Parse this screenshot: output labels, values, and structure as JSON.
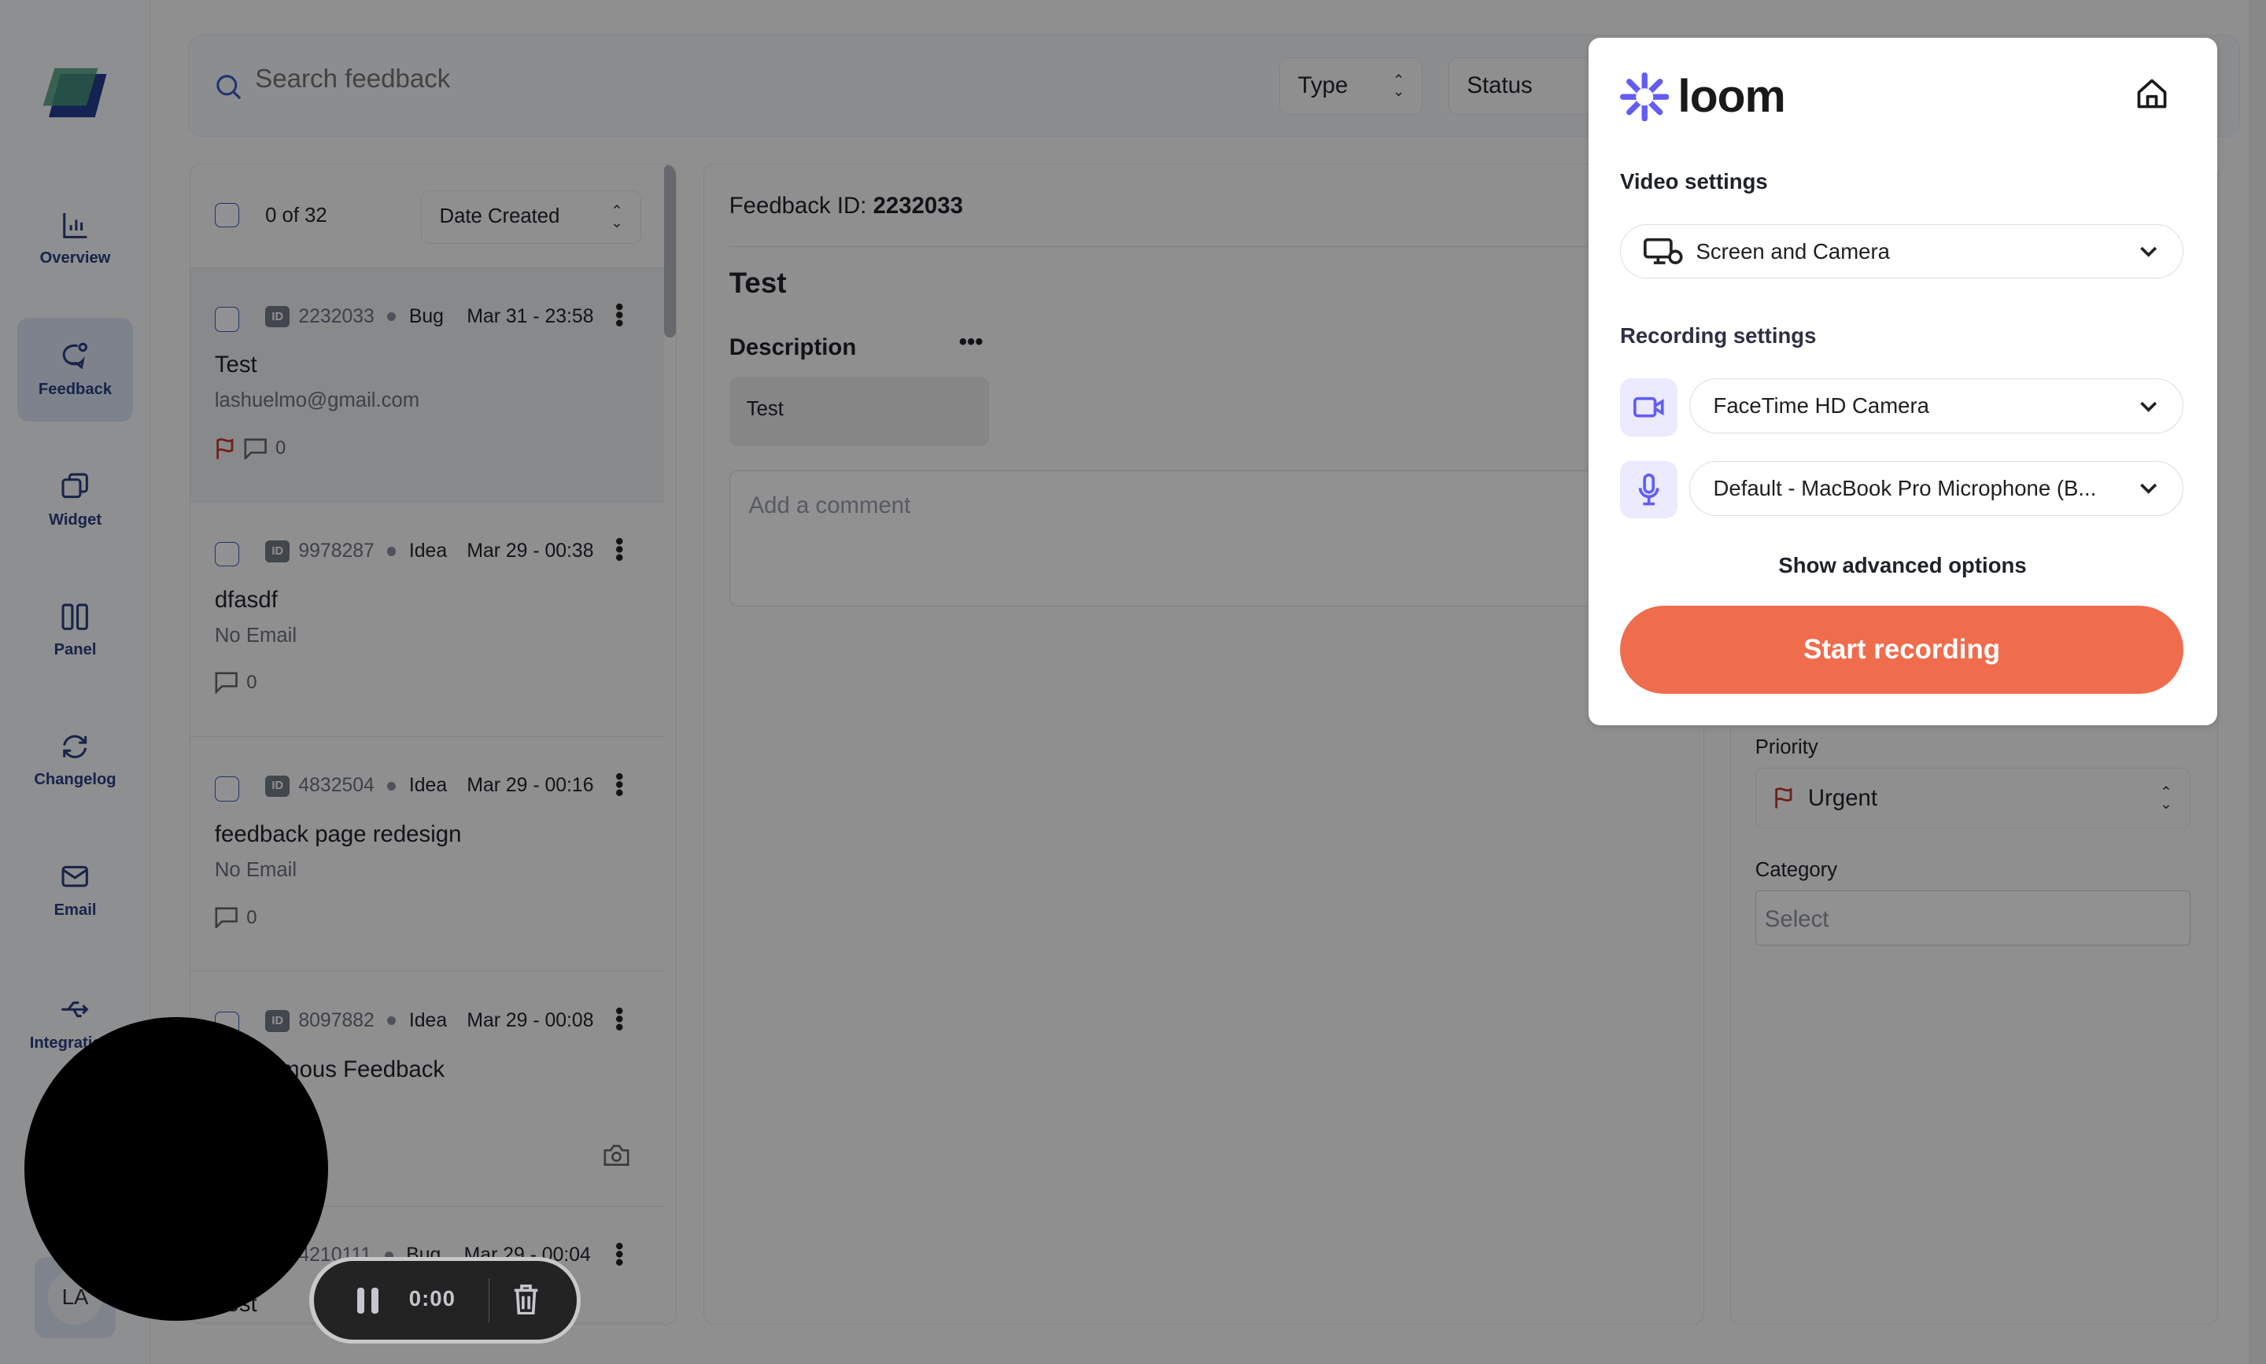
{
  "sidebar": {
    "items": [
      {
        "label": "Overview",
        "icon": "bar-chart-icon"
      },
      {
        "label": "Feedback",
        "icon": "chat-bubble-icon",
        "active": true
      },
      {
        "label": "Widget",
        "icon": "copy-icon"
      },
      {
        "label": "Panel",
        "icon": "columns-icon"
      },
      {
        "label": "Changelog",
        "icon": "refresh-icon"
      },
      {
        "label": "Email",
        "icon": "mail-icon"
      },
      {
        "label": "Integrations",
        "icon": "usb-icon"
      }
    ],
    "avatar": "LA"
  },
  "search": {
    "placeholder": "Search feedback"
  },
  "filters": {
    "type": "Type",
    "status": "Status"
  },
  "list": {
    "count": "0 of 32",
    "sort": "Date Created",
    "items": [
      {
        "id": "2232033",
        "type": "Bug",
        "date": "Mar 31 - 23:58",
        "title": "Test",
        "email": "lashuelmo@gmail.com",
        "comments": "0",
        "flag": true
      },
      {
        "id": "9978287",
        "type": "Idea",
        "date": "Mar 29 - 00:38",
        "title": "dfasdf",
        "email": "No Email",
        "comments": "0"
      },
      {
        "id": "4832504",
        "type": "Idea",
        "date": "Mar 29 - 00:16",
        "title": "feedback page redesign",
        "email": "No Email",
        "comments": "0"
      },
      {
        "id": "8097882",
        "type": "Idea",
        "date": "Mar 29 - 00:08",
        "title": "Anonymous Feedback",
        "email": "",
        "camera": true
      },
      {
        "id": "4210111",
        "type": "Bug",
        "date": "Mar 29 - 00:04",
        "title": "Test",
        "email": ""
      }
    ]
  },
  "detail": {
    "id_label": "Feedback ID:",
    "id_value": "2232033",
    "title": "Test",
    "description_label": "Description",
    "description": "Test",
    "comment_placeholder": "Add a comment"
  },
  "props": {
    "priority_label": "Priority",
    "priority_value": "Urgent",
    "category_label": "Category",
    "category_placeholder": "Select"
  },
  "loom": {
    "brand": "loom",
    "video_settings_label": "Video settings",
    "video_mode": "Screen and Camera",
    "recording_settings_label": "Recording settings",
    "camera": "FaceTime HD Camera",
    "microphone": "Default - MacBook Pro Microphone (B...",
    "advanced": "Show advanced options",
    "start": "Start recording",
    "accent": "#ef6c4d",
    "brand_color": "#625df5"
  },
  "recorder": {
    "time": "0:00"
  }
}
